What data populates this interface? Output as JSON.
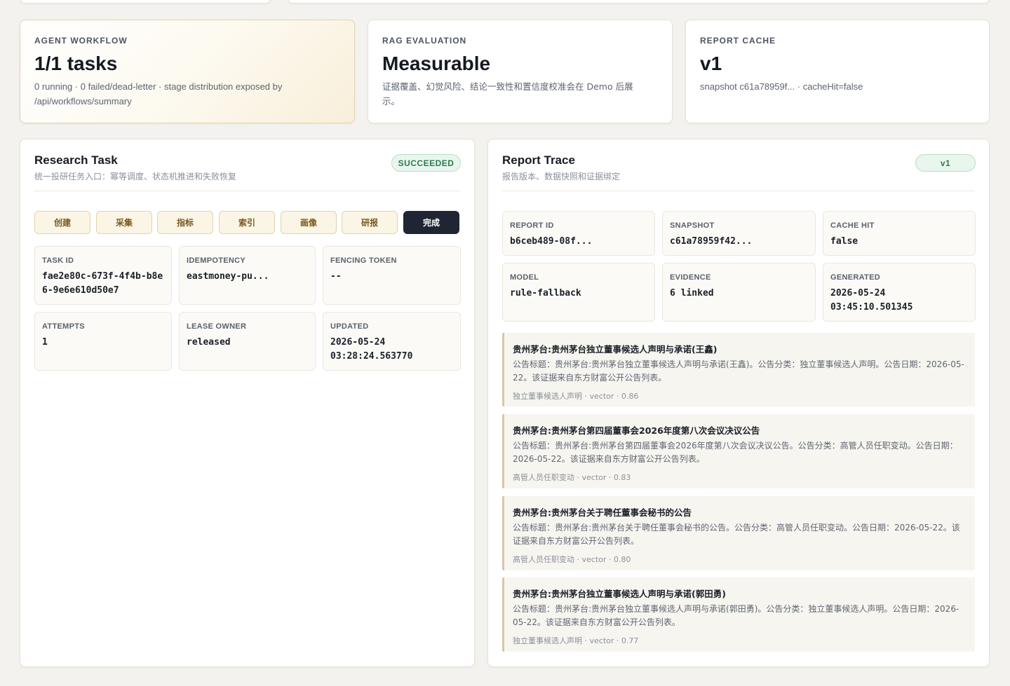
{
  "kpis": {
    "workflow": {
      "label": "AGENT WORKFLOW",
      "value": "1/1 tasks",
      "sub": "0 running · 0 failed/dead-letter · stage distribution exposed by /api/workflows/summary"
    },
    "rag": {
      "label": "RAG EVALUATION",
      "value": "Measurable",
      "sub": "证据覆盖、幻觉风险、结论一致性和置信度校准会在 Demo 后展示。"
    },
    "cache": {
      "label": "REPORT CACHE",
      "value": "v1",
      "sub": "snapshot c61a78959f... · cacheHit=false"
    }
  },
  "research_task": {
    "title": "Research Task",
    "subtitle": "统一投研任务入口：幂等调度、状态机推进和失败恢复",
    "status": "SUCCEEDED",
    "stages": [
      "创建",
      "采集",
      "指标",
      "索引",
      "画像",
      "研报",
      "完成"
    ],
    "fields": {
      "task_id": {
        "label": "TASK ID",
        "value": "fae2e80c-673f-4f4b-b8e6-9e6e610d50e7"
      },
      "idempotency": {
        "label": "IDEMPOTENCY",
        "value": "eastmoney-pu..."
      },
      "fencing_token": {
        "label": "FENCING TOKEN",
        "value": "--"
      },
      "attempts": {
        "label": "ATTEMPTS",
        "value": "1"
      },
      "lease_owner": {
        "label": "LEASE OWNER",
        "value": "released"
      },
      "updated": {
        "label": "UPDATED",
        "value": "2026-05-24 03:28:24.563770"
      }
    }
  },
  "report_trace": {
    "title": "Report Trace",
    "subtitle": "报告版本、数据快照和证据绑定",
    "version_badge": "v1",
    "fields": {
      "report_id": {
        "label": "REPORT ID",
        "value": "b6ceb489-08f..."
      },
      "snapshot": {
        "label": "SNAPSHOT",
        "value": "c61a78959f42..."
      },
      "cache_hit": {
        "label": "CACHE HIT",
        "value": "false"
      },
      "model": {
        "label": "MODEL",
        "value": "rule-fallback"
      },
      "evidence": {
        "label": "EVIDENCE",
        "value": "6 linked"
      },
      "generated": {
        "label": "GENERATED",
        "value": "2026-05-24 03:45:10.501345"
      }
    },
    "evidence_items": [
      {
        "title": "贵州茅台:贵州茅台独立董事候选人声明与承诺(王鑫)",
        "body": "公告标题：贵州茅台:贵州茅台独立董事候选人声明与承诺(王鑫)。公告分类：独立董事候选人声明。公告日期：2026-05-22。该证据来自东方财富公开公告列表。",
        "meta": "独立董事候选人声明 · vector · 0.86"
      },
      {
        "title": "贵州茅台:贵州茅台第四届董事会2026年度第八次会议决议公告",
        "body": "公告标题：贵州茅台:贵州茅台第四届董事会2026年度第八次会议决议公告。公告分类：高管人员任职变动。公告日期：2026-05-22。该证据来自东方财富公开公告列表。",
        "meta": "高管人员任职变动 · vector · 0.83"
      },
      {
        "title": "贵州茅台:贵州茅台关于聘任董事会秘书的公告",
        "body": "公告标题：贵州茅台:贵州茅台关于聘任董事会秘书的公告。公告分类：高管人员任职变动。公告日期：2026-05-22。该证据来自东方财富公开公告列表。",
        "meta": "高管人员任职变动 · vector · 0.80"
      },
      {
        "title": "贵州茅台:贵州茅台独立董事候选人声明与承诺(郭田勇)",
        "body": "公告标题：贵州茅台:贵州茅台独立董事候选人声明与承诺(郭田勇)。公告分类：独立董事候选人声明。公告日期：2026-05-22。该证据来自东方财富公开公告列表。",
        "meta": "独立董事候选人声明 · vector · 0.77"
      }
    ]
  }
}
